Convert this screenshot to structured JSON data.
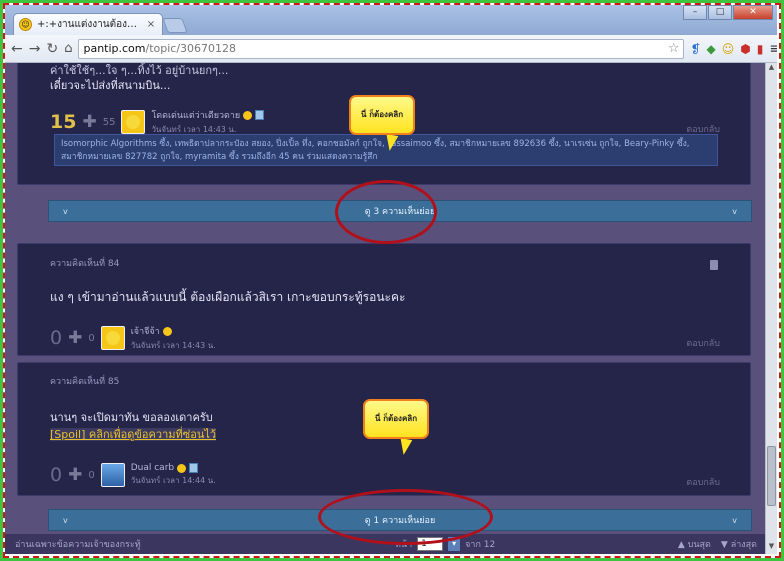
{
  "browser": {
    "tab_title": "+:+งานแต่งงานต้องยกเลิก...",
    "tab_close": "×",
    "url_host": "pantip.com",
    "url_path": "/topic/30670128"
  },
  "post_top": {
    "body_line1": "ค่าใช้ใช้ๆ...ใจ ๆ...ทิ้งไว้ อยู่บ้านยกๆ...",
    "body_line2": "เดี๋ยวจะไปส่งที่สนามบิน...",
    "score": "15",
    "emo_count": "55",
    "username": "โดดเด่นแต่ว่าเดียวดาย",
    "timestamp": "วันจันทร์ เวลา 14:43 น.",
    "reply": "ตอบกลับ",
    "emotions": "Isomorphic Algorithms ซึ้ง, เทพธิดาปลากระป๋อง สยอง, ปิ่งเปิ้ล ทึ่ง, คอกชอมัลก์ ถูกใจ, Tassaimoo ซึ้ง, สมาชิกหมายเลข 892636 ซึ้ง, นาเรเซ่น ถูกใจ, Beary-Pinky ซึ้ง, สมาชิกหมายเลข 827782 ถูกใจ, myramita ซึ้ง รวมถึงอีก 45 คน ร่วมแสดงความรู้สึก"
  },
  "expander1": {
    "label": "ดู 3 ความเห็นย่อย"
  },
  "comment84": {
    "title": "ความคิดเห็นที่ 84",
    "body": "แง ๆ เข้ามาอ่านแล้วแบบนี้ ต้องเผือกแล้วสิเรา เกาะขอบกระทู้รอนะคะ",
    "score": "0",
    "emo_count": "0",
    "username": "เจ้าจีจ้า",
    "timestamp": "วันจันทร์ เวลา 14:43 น.",
    "reply": "ตอบกลับ"
  },
  "comment85": {
    "title": "ความคิดเห็นที่ 85",
    "body": "นานๆ จะเปิดมาทัน ขอลองเดาครับ",
    "spoiler": "[Spoil] คลิกเพื่อดูข้อความที่ซ่อนไว้",
    "score": "0",
    "emo_count": "0",
    "username": "Dual carb",
    "timestamp": "วันจันทร์ เวลา 14:44 น.",
    "reply": "ตอบกลับ"
  },
  "expander2": {
    "label": "ดู 1 ความเห็นย่อย"
  },
  "callouts": {
    "first": "นี่ ก็ต้องคลิก",
    "second": "นี่ ก็ต้องคลิก"
  },
  "bottom": {
    "left_text": "อ่านเฉพาะข้อความเจ้าของกระทู้",
    "page_label": "หน้า",
    "page_value": "1",
    "page_of": "จาก 12",
    "top_link": "บนสุด",
    "bottom_link": "ล่างสุด"
  },
  "colors": {
    "annotation_red": "#b1101a",
    "callout_yellow": "#ffe320",
    "page_bg": "#5a507c",
    "card_bg": "#252449"
  }
}
